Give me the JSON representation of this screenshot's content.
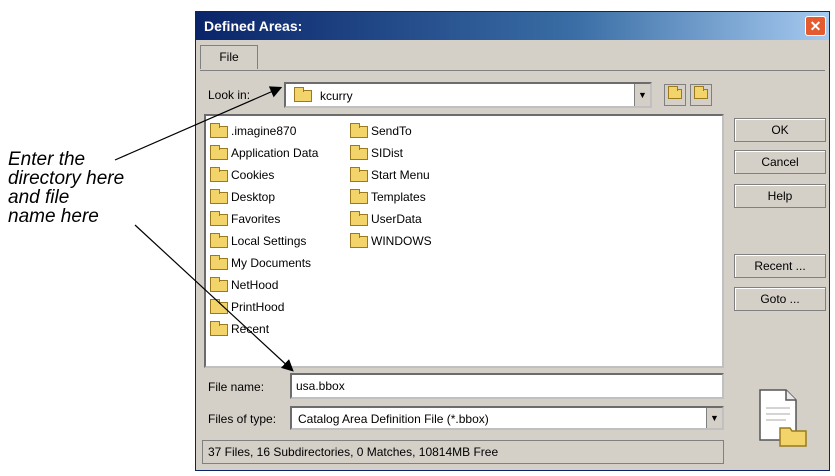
{
  "annotation": {
    "lines": [
      "Enter the",
      "directory here",
      "and file",
      "name here"
    ]
  },
  "dialog": {
    "title": "Defined Areas:",
    "menu": {
      "file": "File"
    },
    "look_in_label": "Look in:",
    "look_in_value": "kcurry",
    "folders_col1": [
      ".imagine870",
      "Application Data",
      "Cookies",
      "Desktop",
      "Favorites",
      "Local Settings",
      "My Documents",
      "NetHood",
      "PrintHood",
      "Recent"
    ],
    "folders_col2": [
      "SendTo",
      "SIDist",
      "Start Menu",
      "Templates",
      "UserData",
      "WINDOWS"
    ],
    "buttons": {
      "ok": "OK",
      "cancel": "Cancel",
      "help": "Help",
      "recent": "Recent ...",
      "goto": "Goto ..."
    },
    "file_name_label": "File name:",
    "file_name_value": "usa.bbox",
    "files_of_type_label": "Files of type:",
    "files_of_type_value": "Catalog Area Definition File (*.bbox)",
    "status": "37 Files, 16 Subdirectories, 0 Matches, 10814MB Free"
  },
  "icons": {
    "close": "close-icon",
    "folder": "folder-icon",
    "up_folder": "up-folder-icon",
    "new_folder": "new-folder-icon",
    "document_open": "document-open-icon"
  },
  "colors": {
    "title_bar": "#0a246a",
    "dialog_bg": "#d4d0c8",
    "close_button": "#e35b2e",
    "folder": "#f2d46a"
  }
}
